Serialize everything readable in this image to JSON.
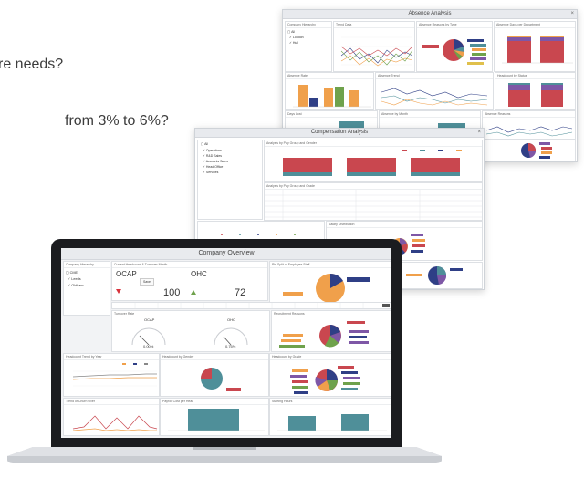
{
  "questions": {
    "line1": "re needs?",
    "line2": "from 3% to 6%?"
  },
  "absence_window": {
    "title": "Absence Analysis",
    "panels": {
      "company_hierarchy": "Company Hierarchy",
      "trend": "Trend Data",
      "absence_by_reason": "Absence Reasons by Type",
      "absence_by_department": "Absence Days per Department",
      "absence_rate": "Absence Rate",
      "trend_lines": "Absence Trend",
      "days_lost": "Days Lost",
      "headcount": "Headcount by Status",
      "trend_by_month": "Absence by Month",
      "small_pie": "Absence Reasons"
    },
    "tree": [
      "All",
      "London",
      "Hull"
    ]
  },
  "compensation_window": {
    "title": "Compensation Analysis",
    "tree": [
      "All",
      "Operations",
      "R&D Sales",
      "Accounts Sales",
      "Head Office",
      "Services"
    ],
    "panels": {
      "by_gender": "Analysis by Pay Group and Gender",
      "pay_table": "Analysis by Pay Group and Grade",
      "pay_spread": "Salary Distribution"
    }
  },
  "overview_window": {
    "title": "Company Overview",
    "hierarchy_title": "Company Hierarchy",
    "tree": [
      "CME",
      "Leeds",
      "Oldham"
    ],
    "kpi_title": "Current Headcount & Turnover Month",
    "kpi_ocap_label": "OCAP",
    "kpi_ocap_value": "100",
    "kpi_ohc_label": "OHC",
    "kpi_ohc_value": "72",
    "kpi_button": "Save",
    "pie_title": "Pie Split of Employee Staff",
    "gauges_title": "Turnover Rate",
    "gauge_left_label": "OCAP",
    "gauge_left_value": "0.00%",
    "gauge_right_label": "OHC",
    "gauge_right_value": "0.75%",
    "reasons_title": "Recruitment Reasons",
    "lines_title": "Headcount Trend by Year",
    "pie2_title": "Headcount by Gender",
    "pie3_title": "Headcount by Grade",
    "bottom_left_title": "Trend of Churn Over",
    "bottom_mid_title": "Payroll Cost per Head",
    "bottom_right_title": "Starting Hours"
  },
  "colors": {
    "teal": "#4f8f99",
    "red": "#c9474f",
    "orange": "#f0a04b",
    "navy": "#2f3f86",
    "purple": "#7e57a6",
    "green": "#6fa24c"
  }
}
